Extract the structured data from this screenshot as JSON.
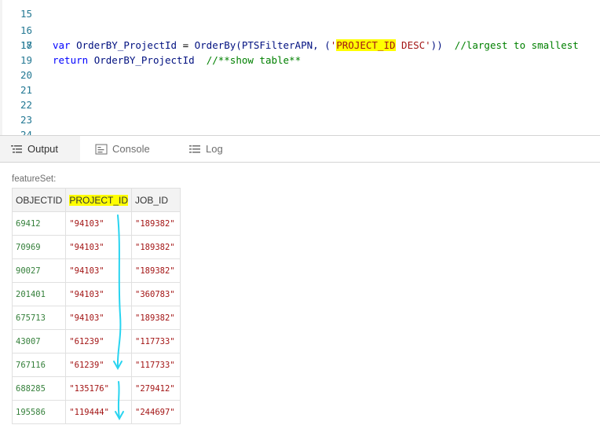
{
  "editor": {
    "lines": [
      {
        "num": "15",
        "code": ""
      },
      {
        "num": "16",
        "code": "var OrderBY_ProjectId = OrderBy(PTSFilterAPN, ('PROJECT_ID DESC'))  //largest to smallest"
      },
      {
        "num": "17",
        "code": "return OrderBY_ProjectId  //**show table**"
      },
      {
        "num": "18",
        "code": ""
      },
      {
        "num": "19",
        "code": ""
      },
      {
        "num": "20",
        "code": ""
      },
      {
        "num": "21",
        "code": ""
      },
      {
        "num": "22",
        "code": ""
      },
      {
        "num": "23",
        "code": ""
      },
      {
        "num": "24",
        "code": ""
      }
    ],
    "line16": {
      "kw": "var",
      "ident": "OrderBY_ProjectId",
      "eq": " = ",
      "func": "OrderBy(PTSFilterAPN, (",
      "str_open": "'",
      "str_hl": "PROJECT_ID",
      "str_rest": " DESC'",
      "close": "))",
      "comment": "//largest to smallest"
    },
    "line17": {
      "kw": "return",
      "ident": "OrderBY_ProjectId",
      "comment": "//**show table**"
    }
  },
  "tabs": [
    {
      "label": "Output",
      "icon": "list-icon",
      "active": true
    },
    {
      "label": "Console",
      "icon": "console-icon",
      "active": false
    },
    {
      "label": "Log",
      "icon": "log-icon",
      "active": false
    }
  ],
  "output": {
    "label": "featureSet:",
    "columns": [
      "OBJECTID",
      "PROJECT_ID",
      "JOB_ID"
    ],
    "rows": [
      [
        "69412",
        "\"94103\"",
        "\"189382\""
      ],
      [
        "70969",
        "\"94103\"",
        "\"189382\""
      ],
      [
        "90027",
        "\"94103\"",
        "\"189382\""
      ],
      [
        "201401",
        "\"94103\"",
        "\"360783\""
      ],
      [
        "675713",
        "\"94103\"",
        "\"189382\""
      ],
      [
        "43007",
        "\"61239\"",
        "\"117733\""
      ],
      [
        "767116",
        "\"61239\"",
        "\"117733\""
      ],
      [
        "688285",
        "\"135176\"",
        "\"279412\""
      ],
      [
        "195586",
        "\"119444\"",
        "\"244697\""
      ]
    ]
  },
  "colors": {
    "highlight": "#ffff00",
    "annotation_arrow": "#29d4f0",
    "number": "#35803b",
    "string": "#a31515"
  }
}
